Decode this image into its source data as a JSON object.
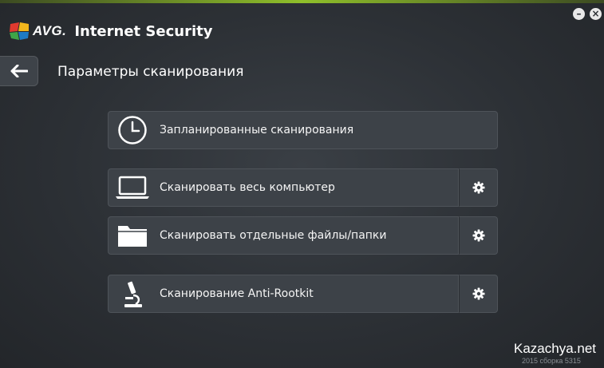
{
  "window": {
    "minimize_label": "–",
    "close_label": "×"
  },
  "app": {
    "logo_text": "AVG.",
    "title": "Internet Security",
    "logo_colors": [
      "#e03a2f",
      "#f2b61c",
      "#3fa548",
      "#1e7bc4"
    ]
  },
  "page": {
    "back_icon": "arrow-left-icon",
    "title": "Параметры сканирования"
  },
  "scans": [
    {
      "label": "Запланированные сканирования",
      "icon": "clock-icon",
      "has_settings": false
    },
    {
      "label": "Сканировать весь компьютер",
      "icon": "laptop-icon",
      "has_settings": true
    },
    {
      "label": "Сканировать отдельные файлы/папки",
      "icon": "folder-icon",
      "has_settings": true
    },
    {
      "label": "Сканирование Anti-Rootkit",
      "icon": "microscope-icon",
      "has_settings": true
    }
  ],
  "footer": {
    "watermark": "Kazachya.net",
    "build": "2015  сборка 5315"
  }
}
